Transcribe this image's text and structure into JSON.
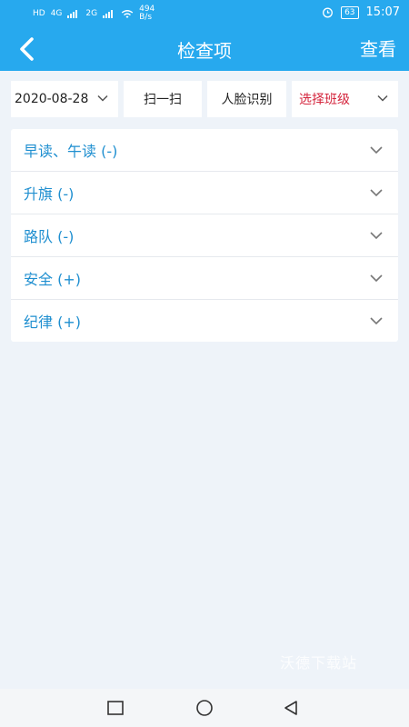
{
  "status": {
    "hd": "HD",
    "net1": "4G",
    "net2": "2G",
    "speed": "494 B/s",
    "battery": "63",
    "time": "15:07"
  },
  "appbar": {
    "title": "检查项",
    "action": "查看"
  },
  "toolbar": {
    "date": "2020-08-28",
    "scan": "扫一扫",
    "face": "人脸识别",
    "class_select": "选择班级"
  },
  "accordion": [
    {
      "label": "早读、午读 (-)"
    },
    {
      "label": "升旗 (-)"
    },
    {
      "label": "路队 (-)"
    },
    {
      "label": "安全 (+)"
    },
    {
      "label": "纪律 (+)"
    }
  ],
  "watermark": "沃德下载站",
  "colors": {
    "primary": "#27a9ee",
    "accent_text": "#1f8fd0",
    "highlight": "#d4243c"
  }
}
